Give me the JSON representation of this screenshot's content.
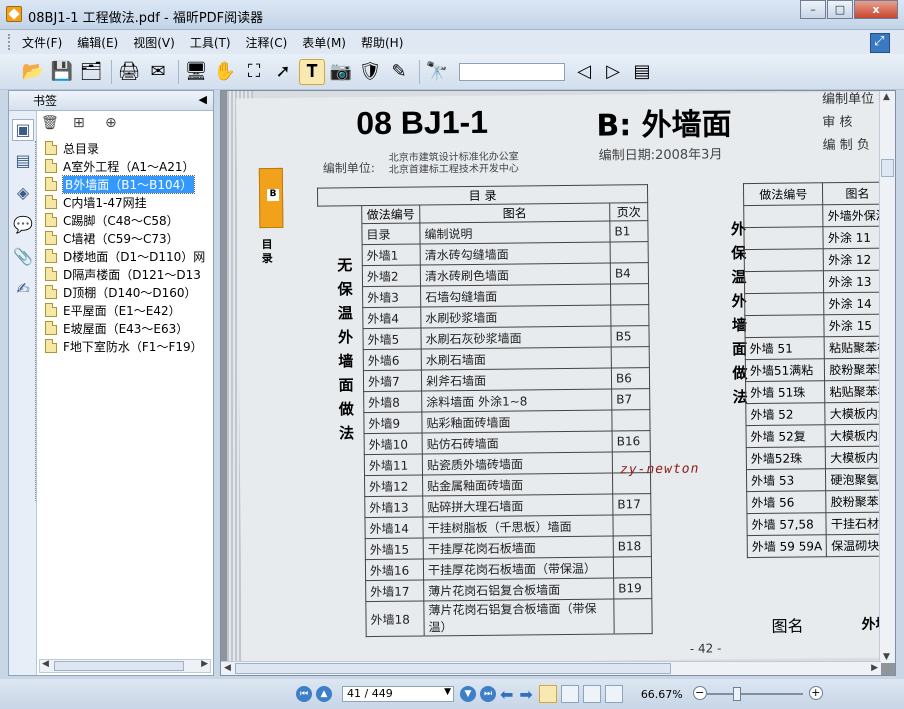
{
  "window": {
    "title": "08BJ1-1 工程做法.pdf - 福昕PDF阅读器",
    "buttons": {
      "minimize": "–",
      "maximize": "□",
      "close": "x"
    }
  },
  "menu": [
    "文件(F)",
    "编辑(E)",
    "视图(V)",
    "工具(T)",
    "注释(C)",
    "表单(M)",
    "帮助(H)"
  ],
  "toolbar": {
    "icons": [
      "open-icon",
      "save-icon",
      "save-as-icon",
      "print-icon",
      "email-icon",
      "fullscreen-icon",
      "hand-icon",
      "select-region-icon",
      "pointer-icon",
      "text-select-icon",
      "snapshot-icon",
      "rms-icon",
      "sign-icon",
      "binoculars-icon"
    ],
    "search_value": ""
  },
  "bookmarks": {
    "header": "书签",
    "items": [
      {
        "label": "总目录",
        "selected": false
      },
      {
        "label": "A室外工程（A1～A21）",
        "selected": false
      },
      {
        "label": "B外墙面（B1～B104）",
        "selected": true
      },
      {
        "label": "C内墙1-47网挂",
        "selected": false
      },
      {
        "label": "C踢脚（C48～C58）",
        "selected": false
      },
      {
        "label": "C墙裙（C59～C73）",
        "selected": false
      },
      {
        "label": "D楼地面（D1～D110）网",
        "selected": false
      },
      {
        "label": "D隔声楼面（D121～D13",
        "selected": false
      },
      {
        "label": "D顶棚（D140～D160）",
        "selected": false
      },
      {
        "label": "E平屋面（E1～E42）",
        "selected": false
      },
      {
        "label": "E坡屋面（E43～E63）",
        "selected": false
      },
      {
        "label": "F地下室防水（F1～F19）",
        "selected": false
      }
    ]
  },
  "document": {
    "tab_letter": "B",
    "tab_label": "目录",
    "title": "08 BJ1-1",
    "section_title": "B: 外墙面",
    "org_label": "编制单位:",
    "org_lines": [
      "北京市建筑设计标准化办公室",
      "北京首建标工程技术开发中心"
    ],
    "date": "编制日期:2008年3月",
    "top_right_lines": [
      "编制单位 技",
      "审 核",
      "编 制 负"
    ],
    "left_vertical_heading": "无保温外墙面做法",
    "right_vertical_heading": "外保温外墙面做法",
    "table_header": {
      "mulu": "目 录",
      "code": "做法编号",
      "name": "图名",
      "page": "页次"
    },
    "rows": [
      {
        "code": "目录",
        "name": "编制说明",
        "page": "B1"
      },
      {
        "code": "外墙1",
        "name": "清水砖勾缝墙面",
        "page": ""
      },
      {
        "code": "外墙2",
        "name": "清水砖刷色墙面",
        "page": "B4"
      },
      {
        "code": "外墙3",
        "name": "石墙勾缝墙面",
        "page": ""
      },
      {
        "code": "外墙4",
        "name": "水刷砂浆墙面",
        "page": ""
      },
      {
        "code": "外墙5",
        "name": "水刷石灰砂浆墙面",
        "page": "B5"
      },
      {
        "code": "外墙6",
        "name": "水刷石墙面",
        "page": ""
      },
      {
        "code": "外墙7",
        "name": "剁斧石墙面",
        "page": "B6"
      },
      {
        "code": "外墙8",
        "name": "涂料墙面 外涂1~8",
        "page": "B7"
      },
      {
        "code": "外墙9",
        "name": "贴彩釉面砖墙面",
        "page": ""
      },
      {
        "code": "外墙10",
        "name": "贴仿石砖墙面",
        "page": "B16"
      },
      {
        "code": "外墙11",
        "name": "贴瓷质外墙砖墙面",
        "page": ""
      },
      {
        "code": "外墙12",
        "name": "贴金属釉面砖墙面",
        "page": ""
      },
      {
        "code": "外墙13",
        "name": "贴碎拼大理石墙面",
        "page": "B17"
      },
      {
        "code": "外墙14",
        "name": "干挂树脂板（千思板）墙面",
        "page": ""
      },
      {
        "code": "外墙15",
        "name": "干挂厚花岗石板墙面",
        "page": "B18"
      },
      {
        "code": "外墙16",
        "name": "干挂厚花岗石板墙面（带保温）",
        "page": ""
      },
      {
        "code": "外墙17",
        "name": "薄片花岗石铝复合板墙面",
        "page": "B19"
      },
      {
        "code": "外墙18",
        "name": "薄片花岗石铝复合板墙面（带保温）",
        "page": ""
      }
    ],
    "right_table_header": {
      "code": "做法编号",
      "name": "图名"
    },
    "right_rows": [
      {
        "code": "",
        "name": "外墙外保温"
      },
      {
        "code": "",
        "name": "外涂 11"
      },
      {
        "code": "",
        "name": "外涂 12"
      },
      {
        "code": "",
        "name": "外涂 13"
      },
      {
        "code": "",
        "name": "外涂 14"
      },
      {
        "code": "",
        "name": "外涂 15"
      },
      {
        "code": "外墙 51",
        "name": "粘贴聚苯板"
      },
      {
        "code": "外墙51满粘",
        "name": "胶粉聚苯颗"
      },
      {
        "code": "外墙 51珠",
        "name": "粘贴聚苯板"
      },
      {
        "code": "外墙 52",
        "name": "大模板内置"
      },
      {
        "code": "外墙 52复",
        "name": "大模板内置"
      },
      {
        "code": "外墙52珠",
        "name": "大模板内置"
      },
      {
        "code": "外墙 53",
        "name": "硬泡聚氨酯"
      },
      {
        "code": "外墙 56",
        "name": "胶粉聚苯颗"
      },
      {
        "code": "外墙 57,58",
        "name": "干挂石材保"
      },
      {
        "code": "外墙 59 59A",
        "name": "保温砌块外"
      }
    ],
    "watermark": "zy-newton",
    "page_footer": "- 42 -",
    "footer_label": "图名",
    "footer_value": "外墙"
  },
  "status": {
    "page_field": "41 / 449",
    "zoom": "66.67%"
  },
  "colors": {
    "accent": "#3399ff",
    "tab_orange": "#f2a21a"
  }
}
